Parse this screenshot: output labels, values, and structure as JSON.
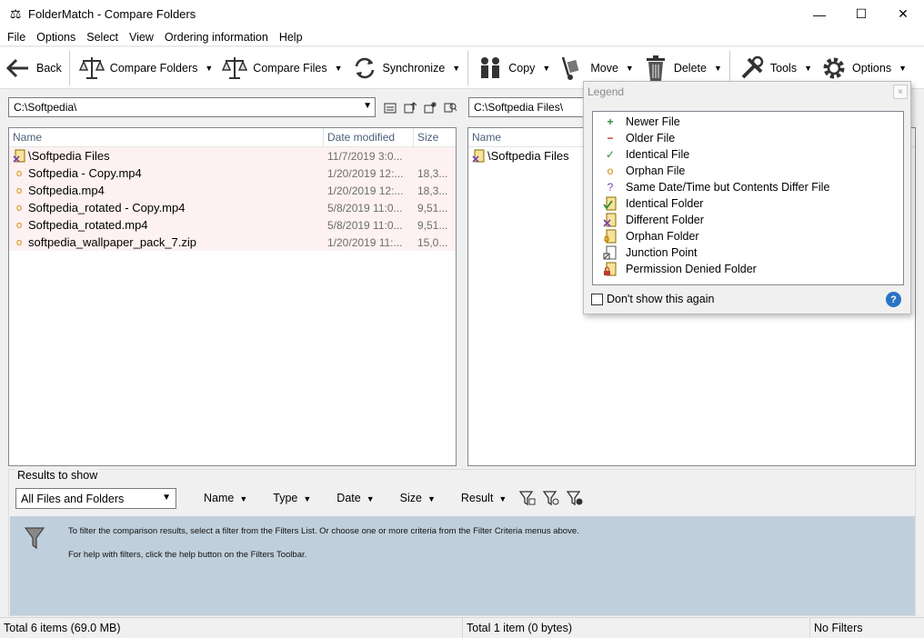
{
  "window": {
    "title": "FolderMatch - Compare Folders"
  },
  "menu": [
    "File",
    "Options",
    "Select",
    "View",
    "Ordering information",
    "Help"
  ],
  "toolbar": {
    "back": "Back",
    "compare_folders": "Compare Folders",
    "compare_files": "Compare Files",
    "synchronize": "Synchronize",
    "copy": "Copy",
    "move": "Move",
    "delete": "Delete",
    "tools": "Tools",
    "options": "Options"
  },
  "left": {
    "path": "C:\\Softpedia\\",
    "columns": [
      "Name",
      "Date modified",
      "Size"
    ],
    "rows": [
      {
        "name": "\\Softpedia Files",
        "date": "11/7/2019 3:0...",
        "size": "",
        "icon": "different-folder-icon"
      },
      {
        "name": "Softpedia - Copy.mp4",
        "date": "1/20/2019 12:...",
        "size": "18,3...",
        "icon": "orphan-file-icon"
      },
      {
        "name": "Softpedia.mp4",
        "date": "1/20/2019 12:...",
        "size": "18,3...",
        "icon": "orphan-file-icon"
      },
      {
        "name": "Softpedia_rotated - Copy.mp4",
        "date": "5/8/2019 11:0...",
        "size": "9,51...",
        "icon": "orphan-file-icon"
      },
      {
        "name": "Softpedia_rotated.mp4",
        "date": "5/8/2019 11:0...",
        "size": "9,51...",
        "icon": "orphan-file-icon"
      },
      {
        "name": "softpedia_wallpaper_pack_7.zip",
        "date": "1/20/2019 11:...",
        "size": "15,0...",
        "icon": "orphan-file-icon"
      }
    ]
  },
  "right": {
    "path": "C:\\Softpedia Files\\",
    "columns": [
      "Name"
    ],
    "rows": [
      {
        "name": "\\Softpedia Files",
        "icon": "different-folder-icon"
      }
    ]
  },
  "legend": {
    "title": "Legend",
    "close": "×",
    "items": [
      {
        "icon": "plus-icon",
        "glyph": "+",
        "color": "#2e8b3a",
        "label": "Newer File"
      },
      {
        "icon": "minus-icon",
        "glyph": "−",
        "color": "#c0392b",
        "label": "Older File"
      },
      {
        "icon": "check-icon",
        "glyph": "✓",
        "color": "#2e8b3a",
        "label": "Identical File"
      },
      {
        "icon": "orphan-file-icon",
        "glyph": "o",
        "color": "#d08a00",
        "label": "Orphan File"
      },
      {
        "icon": "question-icon",
        "glyph": "?",
        "color": "#7a3fb0",
        "label": "Same Date/Time but Contents Differ File"
      },
      {
        "icon": "identical-folder-icon",
        "glyph": "✓",
        "color": "#2e8b3a",
        "label": "Identical Folder"
      },
      {
        "icon": "different-folder-icon",
        "glyph": "✕",
        "color": "#7a3fb0",
        "label": "Different Folder"
      },
      {
        "icon": "orphan-folder-icon",
        "glyph": "o",
        "color": "#d08a00",
        "label": "Orphan Folder"
      },
      {
        "icon": "junction-point-icon",
        "glyph": "↗",
        "color": "#333333",
        "label": "Junction Point"
      },
      {
        "icon": "lock-folder-icon",
        "glyph": "🔒",
        "color": "#c0392b",
        "label": "Permission Denied Folder"
      }
    ],
    "dont_show": "Don't show this again",
    "help": "?"
  },
  "filters": {
    "title": "Results to show",
    "select_value": "All Files and Folders",
    "criteria": [
      "Name",
      "Type",
      "Date",
      "Size",
      "Result"
    ],
    "info1": "To filter the comparison results, select a filter from the Filters List. Or choose one or more criteria from the Filter Criteria menus above.",
    "info2": "For help with filters, click the help button on the Filters Toolbar."
  },
  "status": {
    "left": "Total 6 items (69.0 MB)",
    "right": "Total 1 item (0 bytes)",
    "filters": "No Filters"
  },
  "colors": {
    "pink_row": "#fdf1f1",
    "info_panel": "#c0cfdc",
    "header_text": "#4c607a"
  }
}
